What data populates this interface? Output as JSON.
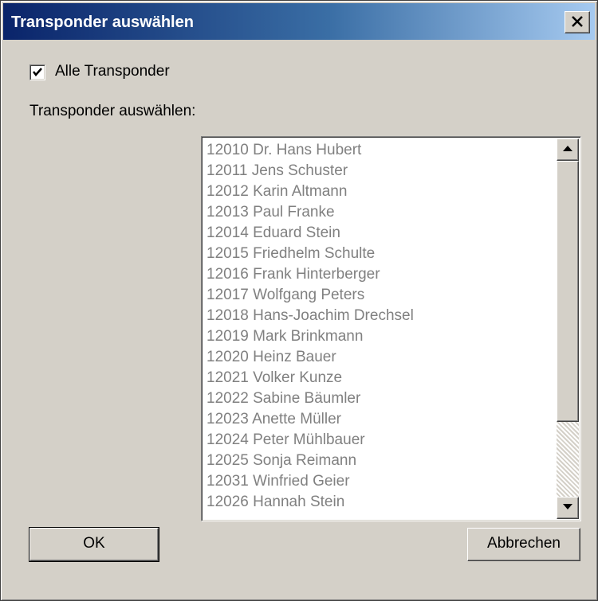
{
  "window": {
    "title": "Transponder auswählen",
    "close_icon": "close-icon"
  },
  "checkbox": {
    "label": "Alle Transponder",
    "checked": true
  },
  "section_label": "Transponder  auswählen:",
  "list": {
    "items": [
      "12010 Dr. Hans Hubert",
      "12011 Jens Schuster",
      "12012 Karin Altmann",
      "12013 Paul Franke",
      "12014 Eduard Stein",
      "12015 Friedhelm Schulte",
      "12016 Frank Hinterberger",
      "12017 Wolfgang Peters",
      "12018 Hans-Joachim Drechsel",
      "12019 Mark Brinkmann",
      "12020 Heinz Bauer",
      "12021 Volker Kunze",
      "12022 Sabine Bäumler",
      "12023 Anette Müller",
      "12024 Peter Mühlbauer",
      "12025 Sonja Reimann",
      "12031 Winfried Geier",
      "12026 Hannah Stein"
    ],
    "text_color": "#808080"
  },
  "buttons": {
    "ok": "OK",
    "cancel": "Abbrechen"
  },
  "colors": {
    "titlebar_start": "#0a246a",
    "titlebar_end": "#a6caf0",
    "face": "#d4d0c8"
  }
}
